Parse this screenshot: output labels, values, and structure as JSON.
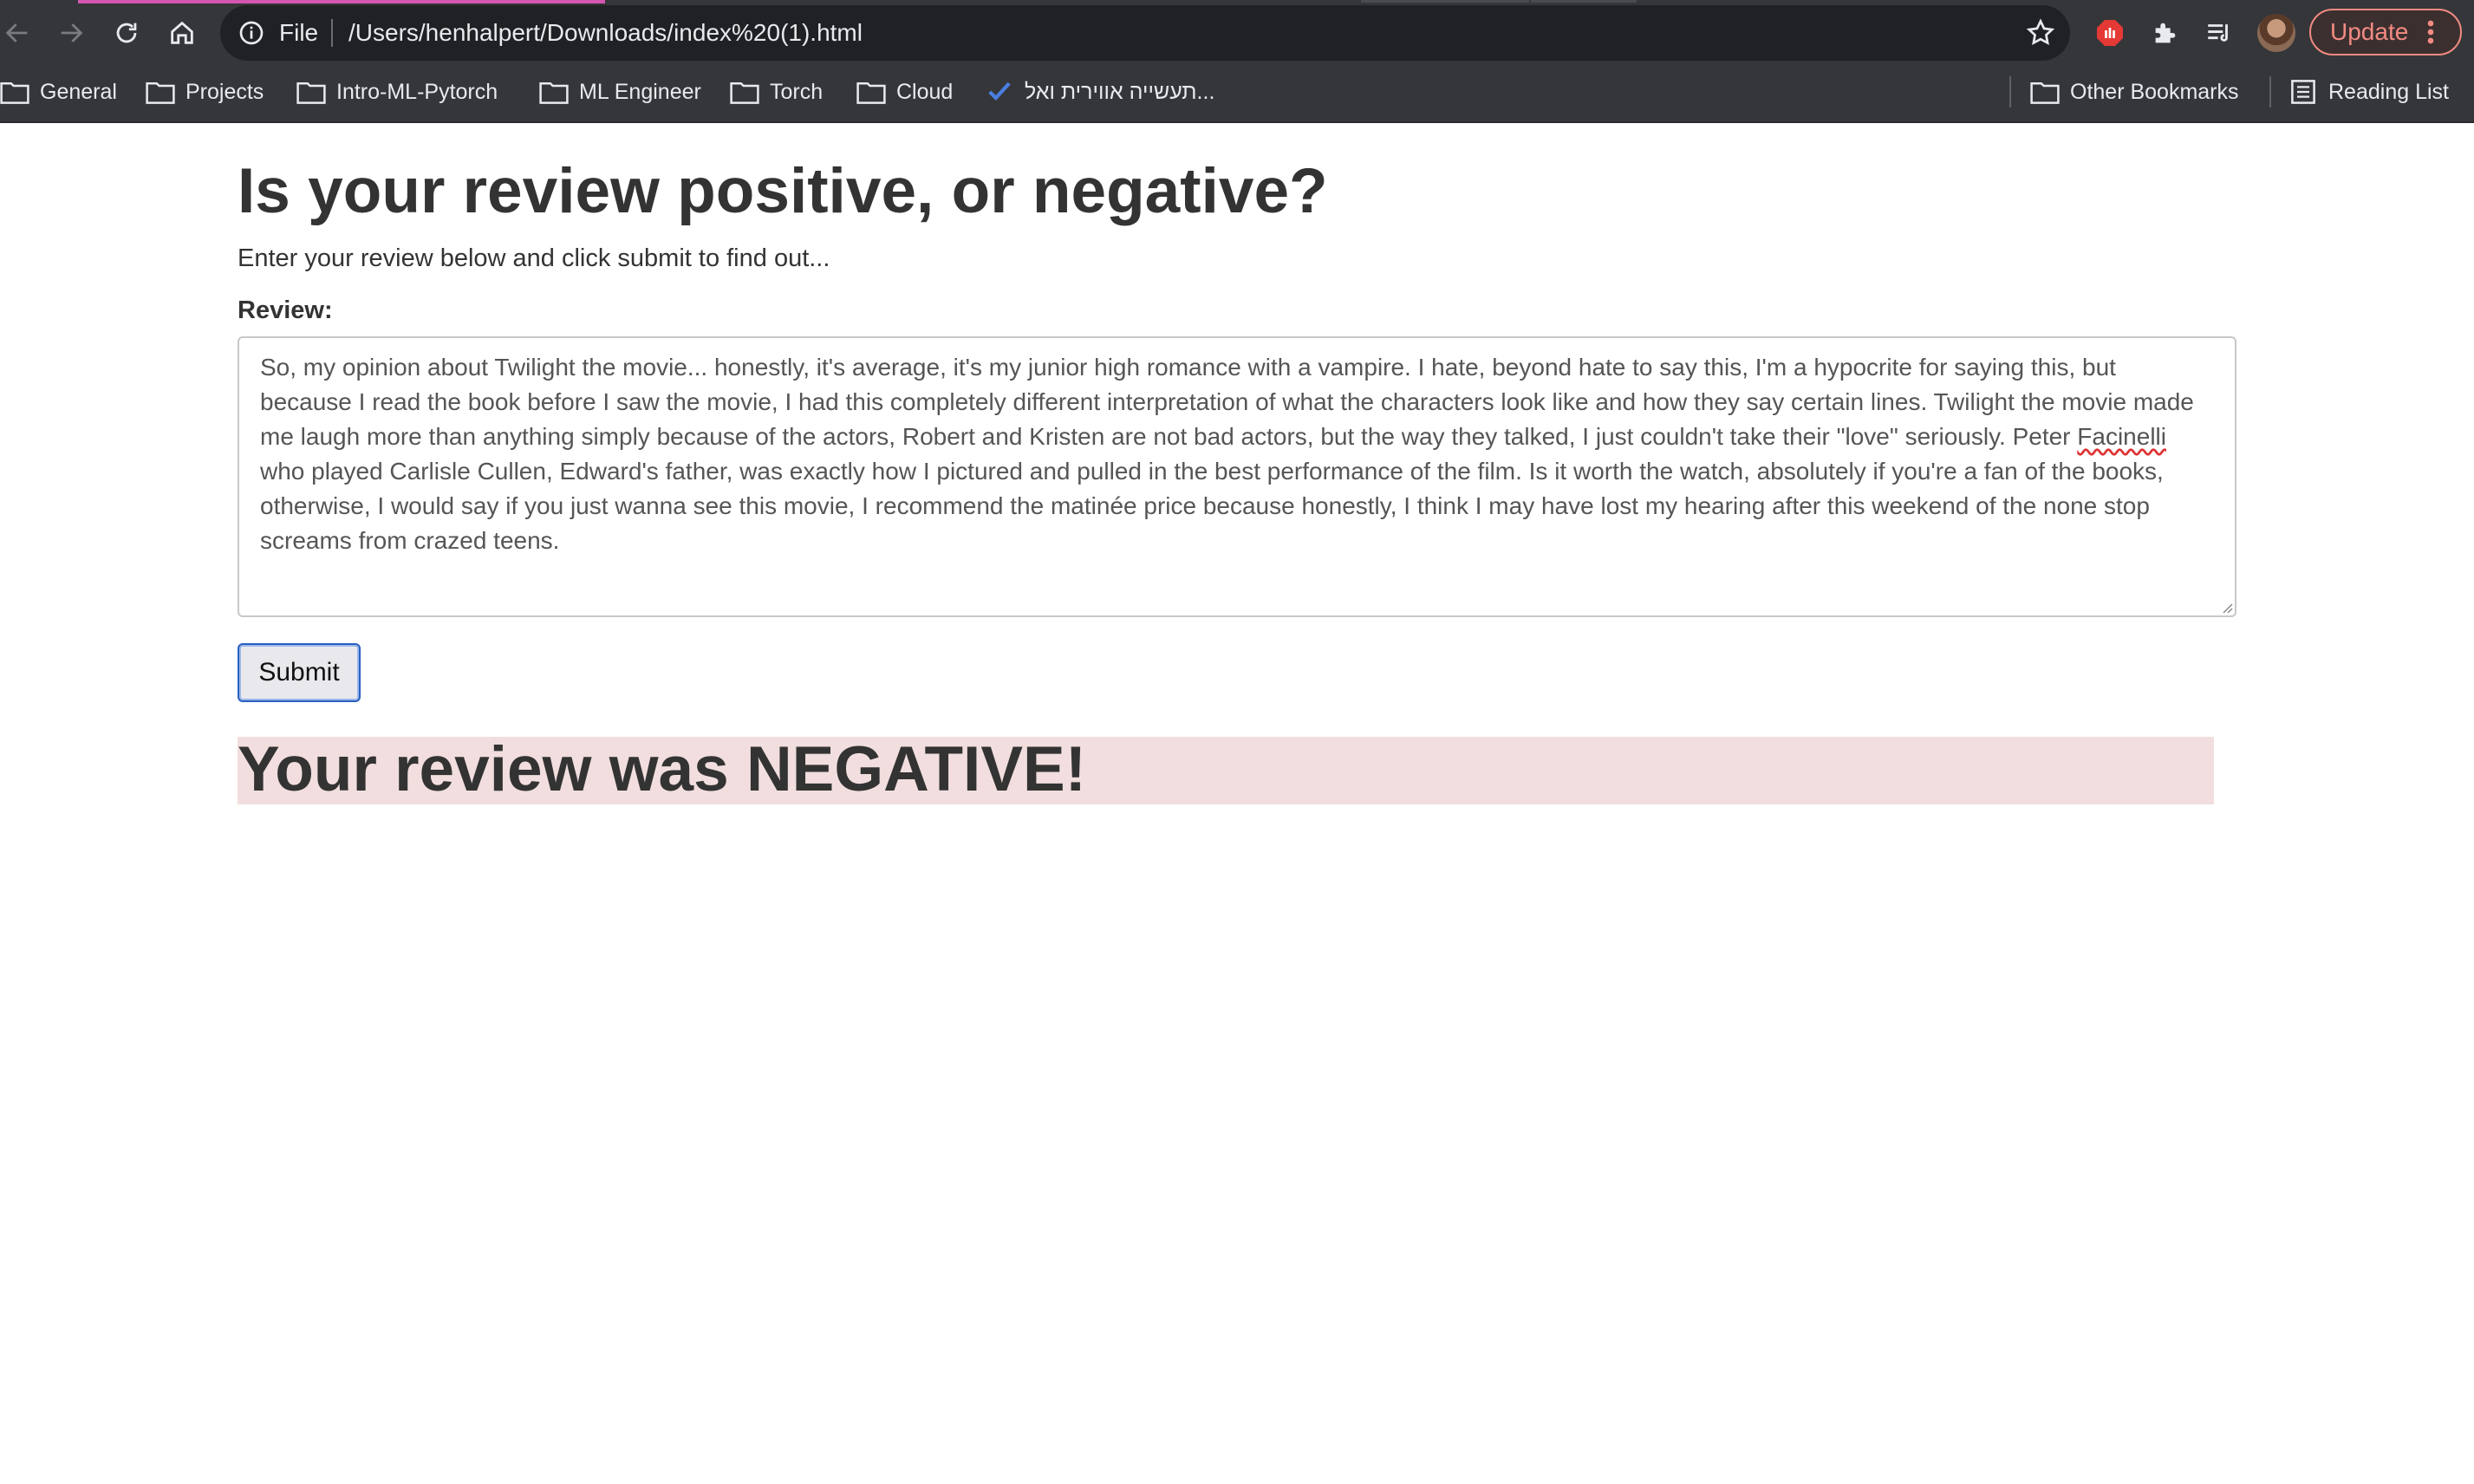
{
  "browser": {
    "scheme_label": "File",
    "url": "/Users/henhalpert/Downloads/index%20(1).html",
    "update_label": "Update",
    "bookmarks": [
      {
        "label": "General"
      },
      {
        "label": "Projects"
      },
      {
        "label": "Intro-ML-Pytorch"
      },
      {
        "label": "ML Engineer"
      },
      {
        "label": "Torch"
      },
      {
        "label": "Cloud"
      },
      {
        "label": "תעשייה אווירית ואל..."
      }
    ],
    "other_bookmarks_label": "Other Bookmarks",
    "reading_list_label": "Reading List"
  },
  "page": {
    "title": "Is your review positive, or negative?",
    "intro": "Enter your review below and click submit to find out...",
    "review_label": "Review:",
    "review_text_before": "So, my opinion about Twilight the movie... honestly, it's average, it's my junior high romance with a vampire. I hate, beyond hate to say this, I'm a hypocrite for saying this, but because I read the book before I saw the movie, I had this completely different interpretation of what the characters look like and how they say certain lines. Twilight the movie made me laugh more than anything simply because of the actors, Robert and Kristen are not bad actors, but the way they talked, I just couldn't take their \"love\" seriously. Peter ",
    "review_text_flagged": "Facinelli",
    "review_text_after": " who played Carlisle Cullen, Edward's father, was exactly how I pictured and pulled in the best performance of the film. Is it worth the watch, absolutely if you're a fan of the books, otherwise, I would say if you just wanna see this movie, I recommend the matinée price because honestly, I think I may have lost my hearing after this weekend of the none stop screams from crazed teens.",
    "submit_label": "Submit",
    "result": "Your review was NEGATIVE!"
  },
  "colors": {
    "chrome_bg": "#35363a",
    "omnibox_bg": "#202124",
    "update_accent": "#f28b82",
    "result_bg": "#f2dede",
    "text": "#333333"
  }
}
